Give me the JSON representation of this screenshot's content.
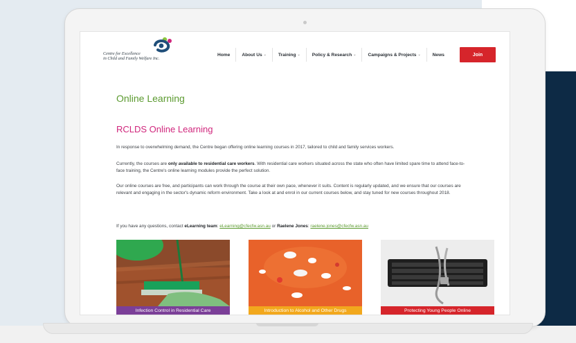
{
  "colors": {
    "brand_green": "#5b9a2f",
    "brand_pink": "#d0267c",
    "join_red": "#d6252b",
    "navy_panel": "#0d2a45",
    "card1_label_bg": "#7b3f98",
    "card2_label_bg": "#f2a81d",
    "card3_label_bg": "#d6252b"
  },
  "header": {
    "logo_line1": "Centre for Excellence",
    "logo_line2": "in Child and Family Welfare Inc.",
    "nav": [
      {
        "label": "Home",
        "dropdown": false
      },
      {
        "label": "About Us",
        "dropdown": true
      },
      {
        "label": "Training",
        "dropdown": true
      },
      {
        "label": "Policy & Research",
        "dropdown": true
      },
      {
        "label": "Campaigns & Projects",
        "dropdown": true
      },
      {
        "label": "News",
        "dropdown": false
      }
    ],
    "join_label": "Join"
  },
  "main": {
    "page_title": "Online Learning",
    "section_title": "RCLDS Online Learning",
    "p1": "In response to overwhelming demand, the Centre began offering online learning courses in 2017, tailored to child and family services workers.",
    "p2_pre": "Currently, the courses are ",
    "p2_bold": "only available to residential care workers",
    "p2_post": ". With residential care workers situated across the state who often have limited spare time to attend face-to-face training, the Centre's online learning modules provide the perfect solution.",
    "p3": "Our online courses are free, and participants can work through the course at their own pace, whenever it suits. Content is regularly updated, and we ensure that our courses are relevant and engaging in the sector's dynamic reform environment. Take a look at and enrol in our current courses below, and stay tuned for new courses throughout 2018.",
    "p4_pre": "If you have any questions, contact ",
    "p4_team": "eLearning team",
    "p4_email1": "eLearning@cfecfw.asn.au",
    "p4_mid": " or ",
    "p4_name2": "Raelene Jones",
    "p4_email2": "raelene.jones@cfecfw.asn.au",
    "courses": [
      {
        "title": "Infection Control in Residential Care",
        "icon": "mop-bucket-image"
      },
      {
        "title": "Introduction to Alcohol and Other Drugs",
        "icon": "pills-image"
      },
      {
        "title": "Protecting Young People Online",
        "icon": "chained-keyboard-image"
      }
    ]
  }
}
